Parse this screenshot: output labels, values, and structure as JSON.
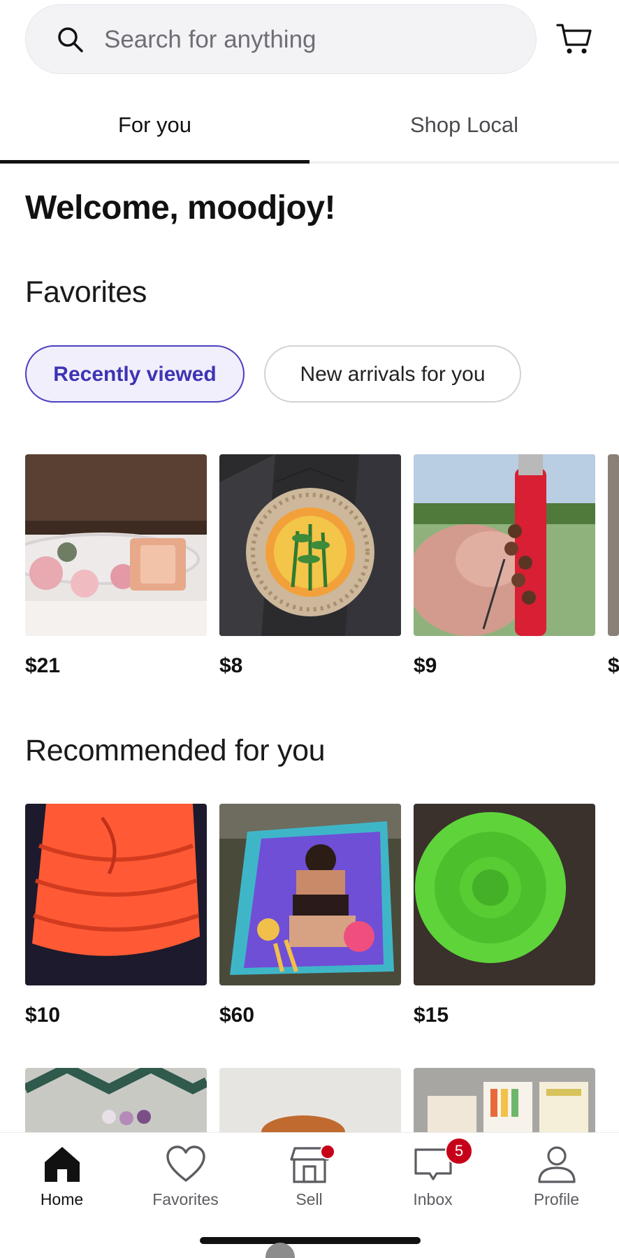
{
  "search": {
    "placeholder": "Search for anything",
    "icon": "search-icon"
  },
  "header": {
    "cart_icon": "cart-icon"
  },
  "tabs": [
    {
      "label": "For you",
      "active": true
    },
    {
      "label": "Shop Local",
      "active": false
    }
  ],
  "welcome": "Welcome, moodjoy!",
  "favorites": {
    "title": "Favorites",
    "chips": [
      {
        "label": "Recently viewed",
        "active": true
      },
      {
        "label": "New arrivals for you",
        "active": false
      }
    ],
    "items": [
      {
        "price": "$21",
        "image": "floral rose dog collar with rose-gold buckle"
      },
      {
        "price": "$8",
        "image": "round woven wall hanging with plant art"
      },
      {
        "price": "$9",
        "image": "beaded keychain on red lighter"
      },
      {
        "price": "$"
      }
    ]
  },
  "recommended": {
    "title": "Recommended for you",
    "items": [
      {
        "price": "$10",
        "image": "orange crochet knit item"
      },
      {
        "price": "$60",
        "image": "colorful illustrated artwork print"
      },
      {
        "price": "$15",
        "image": "green round silicone container"
      }
    ]
  },
  "bottom_nav": [
    {
      "label": "Home",
      "icon": "home-icon",
      "active": true
    },
    {
      "label": "Favorites",
      "icon": "heart-icon",
      "active": false
    },
    {
      "label": "Sell",
      "icon": "shop-icon",
      "active": false,
      "dot": true
    },
    {
      "label": "Inbox",
      "icon": "inbox-icon",
      "active": false,
      "badge": "5"
    },
    {
      "label": "Profile",
      "icon": "profile-icon",
      "active": false
    }
  ],
  "colors": {
    "accent": "#4b3fbf",
    "badge": "#c7001a",
    "text": "#111111"
  }
}
